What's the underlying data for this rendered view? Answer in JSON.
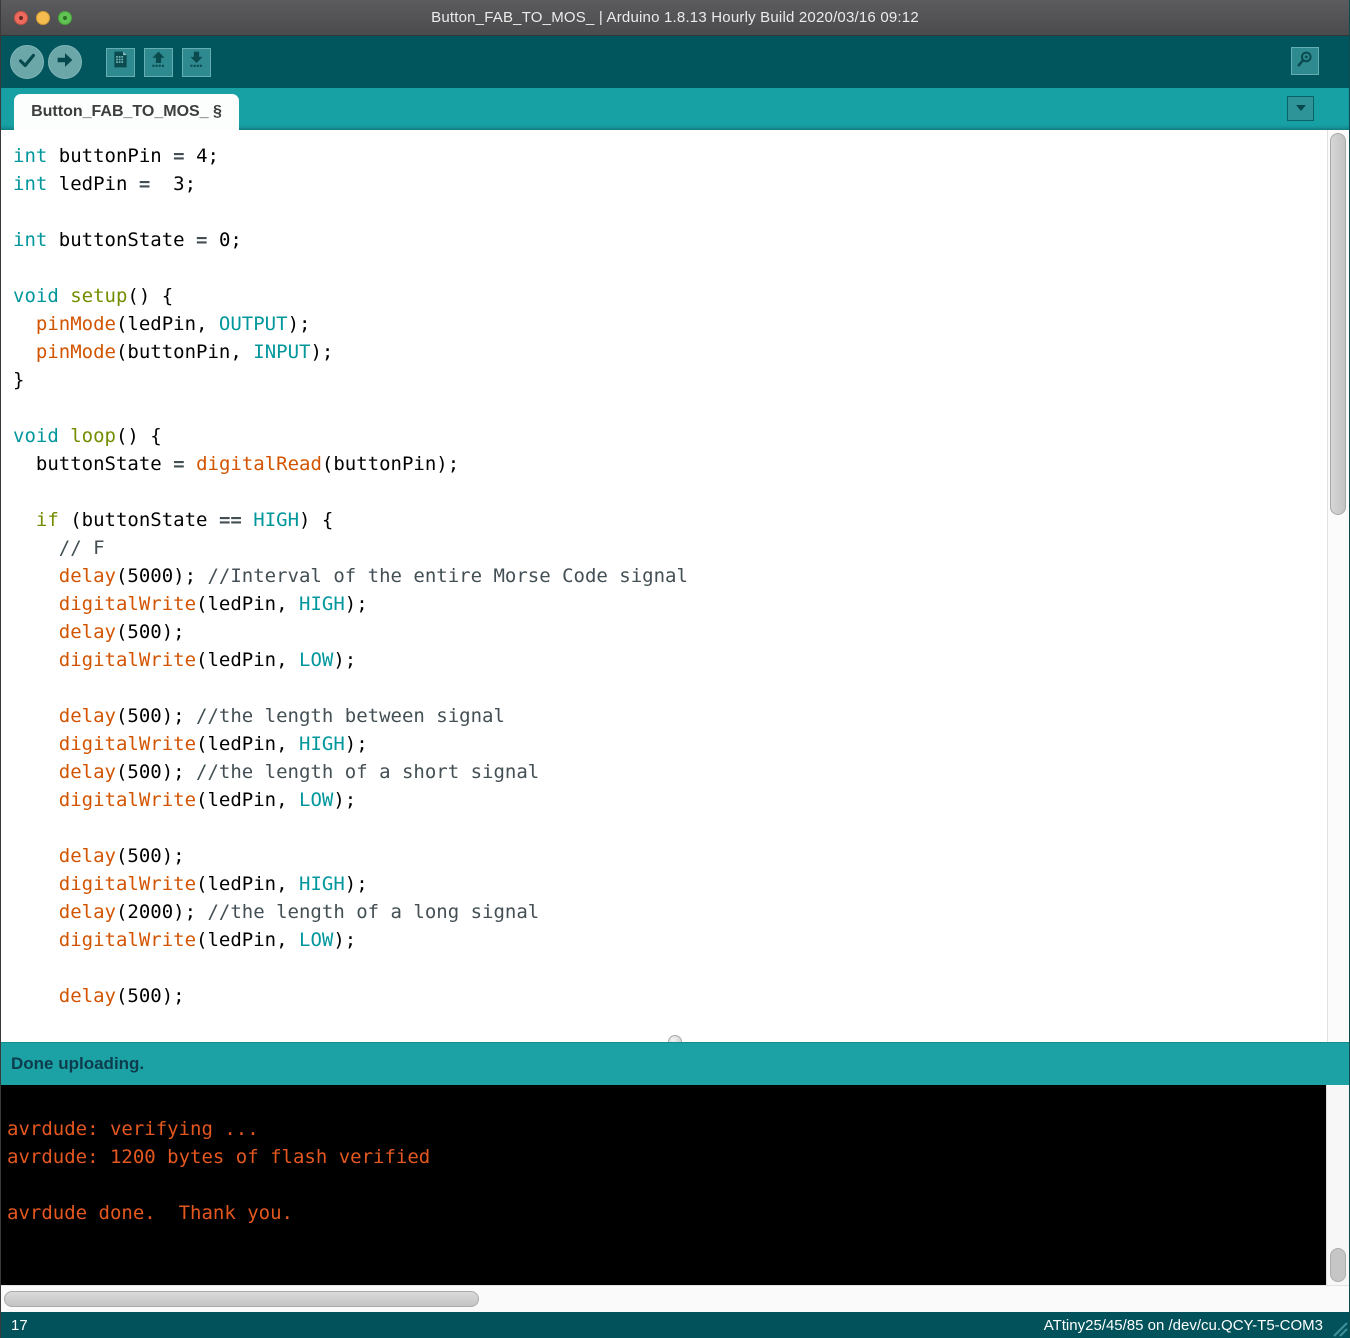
{
  "window": {
    "title": "Button_FAB_TO_MOS_ | Arduino 1.8.13 Hourly Build 2020/03/16 09:12"
  },
  "toolbar": {
    "buttons": [
      "verify",
      "upload",
      "new-sketch",
      "open",
      "save",
      "serial-monitor"
    ]
  },
  "tab": {
    "label": "Button_FAB_TO_MOS_ §"
  },
  "editor": {
    "code_lines": [
      [
        [
          "kw",
          "int"
        ],
        [
          "pl",
          " buttonPin "
        ],
        [
          "op",
          "="
        ],
        [
          "pl",
          " 4;"
        ]
      ],
      [
        [
          "kw",
          "int"
        ],
        [
          "pl",
          " ledPin "
        ],
        [
          "op",
          "="
        ],
        [
          "pl",
          "  3;"
        ]
      ],
      [],
      [
        [
          "kw",
          "int"
        ],
        [
          "pl",
          " buttonState "
        ],
        [
          "op",
          "="
        ],
        [
          "pl",
          " 0;"
        ]
      ],
      [],
      [
        [
          "kw",
          "void"
        ],
        [
          "pl",
          " "
        ],
        [
          "fn2",
          "setup"
        ],
        [
          "pl",
          "() {"
        ]
      ],
      [
        [
          "pl",
          "  "
        ],
        [
          "fn",
          "pinMode"
        ],
        [
          "pl",
          "(ledPin, "
        ],
        [
          "const",
          "OUTPUT"
        ],
        [
          "pl",
          ");"
        ]
      ],
      [
        [
          "pl",
          "  "
        ],
        [
          "fn",
          "pinMode"
        ],
        [
          "pl",
          "(buttonPin, "
        ],
        [
          "const",
          "INPUT"
        ],
        [
          "pl",
          ");"
        ]
      ],
      [
        [
          "pl",
          "}"
        ]
      ],
      [],
      [
        [
          "kw",
          "void"
        ],
        [
          "pl",
          " "
        ],
        [
          "fn2",
          "loop"
        ],
        [
          "pl",
          "() {"
        ]
      ],
      [
        [
          "pl",
          "  buttonState "
        ],
        [
          "op",
          "="
        ],
        [
          "pl",
          " "
        ],
        [
          "fn",
          "digitalRead"
        ],
        [
          "pl",
          "(buttonPin);"
        ]
      ],
      [],
      [
        [
          "pl",
          "  "
        ],
        [
          "kw2",
          "if"
        ],
        [
          "pl",
          " (buttonState "
        ],
        [
          "op",
          "=="
        ],
        [
          "pl",
          " "
        ],
        [
          "const",
          "HIGH"
        ],
        [
          "pl",
          ") {"
        ]
      ],
      [
        [
          "pl",
          "    "
        ],
        [
          "cm",
          "// F"
        ]
      ],
      [
        [
          "pl",
          "    "
        ],
        [
          "fn",
          "delay"
        ],
        [
          "pl",
          "(5000); "
        ],
        [
          "cm",
          "//Interval of the entire Morse Code signal"
        ]
      ],
      [
        [
          "pl",
          "    "
        ],
        [
          "fn",
          "digitalWrite"
        ],
        [
          "pl",
          "(ledPin, "
        ],
        [
          "const",
          "HIGH"
        ],
        [
          "pl",
          ");"
        ]
      ],
      [
        [
          "pl",
          "    "
        ],
        [
          "fn",
          "delay"
        ],
        [
          "pl",
          "(500);"
        ]
      ],
      [
        [
          "pl",
          "    "
        ],
        [
          "fn",
          "digitalWrite"
        ],
        [
          "pl",
          "(ledPin, "
        ],
        [
          "const",
          "LOW"
        ],
        [
          "pl",
          ");"
        ]
      ],
      [],
      [
        [
          "pl",
          "    "
        ],
        [
          "fn",
          "delay"
        ],
        [
          "pl",
          "(500); "
        ],
        [
          "cm",
          "//the length between signal"
        ]
      ],
      [
        [
          "pl",
          "    "
        ],
        [
          "fn",
          "digitalWrite"
        ],
        [
          "pl",
          "(ledPin, "
        ],
        [
          "const",
          "HIGH"
        ],
        [
          "pl",
          ");"
        ]
      ],
      [
        [
          "pl",
          "    "
        ],
        [
          "fn",
          "delay"
        ],
        [
          "pl",
          "(500); "
        ],
        [
          "cm",
          "//the length of a short signal"
        ]
      ],
      [
        [
          "pl",
          "    "
        ],
        [
          "fn",
          "digitalWrite"
        ],
        [
          "pl",
          "(ledPin, "
        ],
        [
          "const",
          "LOW"
        ],
        [
          "pl",
          ");"
        ]
      ],
      [],
      [
        [
          "pl",
          "    "
        ],
        [
          "fn",
          "delay"
        ],
        [
          "pl",
          "(500);"
        ]
      ],
      [
        [
          "pl",
          "    "
        ],
        [
          "fn",
          "digitalWrite"
        ],
        [
          "pl",
          "(ledPin, "
        ],
        [
          "const",
          "HIGH"
        ],
        [
          "pl",
          ");"
        ]
      ],
      [
        [
          "pl",
          "    "
        ],
        [
          "fn",
          "delay"
        ],
        [
          "pl",
          "(2000); "
        ],
        [
          "cm",
          "//the length of a long signal"
        ]
      ],
      [
        [
          "pl",
          "    "
        ],
        [
          "fn",
          "digitalWrite"
        ],
        [
          "pl",
          "(ledPin, "
        ],
        [
          "const",
          "LOW"
        ],
        [
          "pl",
          ");"
        ]
      ],
      [],
      [
        [
          "pl",
          "    "
        ],
        [
          "fn",
          "delay"
        ],
        [
          "pl",
          "(500);"
        ]
      ]
    ]
  },
  "status": {
    "message": "Done uploading."
  },
  "console": {
    "lines": [
      "avrdude: verifying ...",
      "avrdude: 1200 bytes of flash verified",
      "",
      "avrdude done.  Thank you."
    ]
  },
  "footer": {
    "line_number": "17",
    "board_info": "ATtiny25/45/85 on /dev/cu.QCY-T5-COM3"
  },
  "colors": {
    "toolbar_bg": "#00565C",
    "tabstrip_bg": "#18A1A5",
    "status_bg": "#1CA1A5",
    "console_bg": "#000000",
    "console_text": "#E4571E",
    "footer_bg": "#01525A",
    "type_teal": "#00979C",
    "function_orange": "#D35400",
    "keyword_green": "#728E00",
    "comment_gray": "#434F54"
  }
}
